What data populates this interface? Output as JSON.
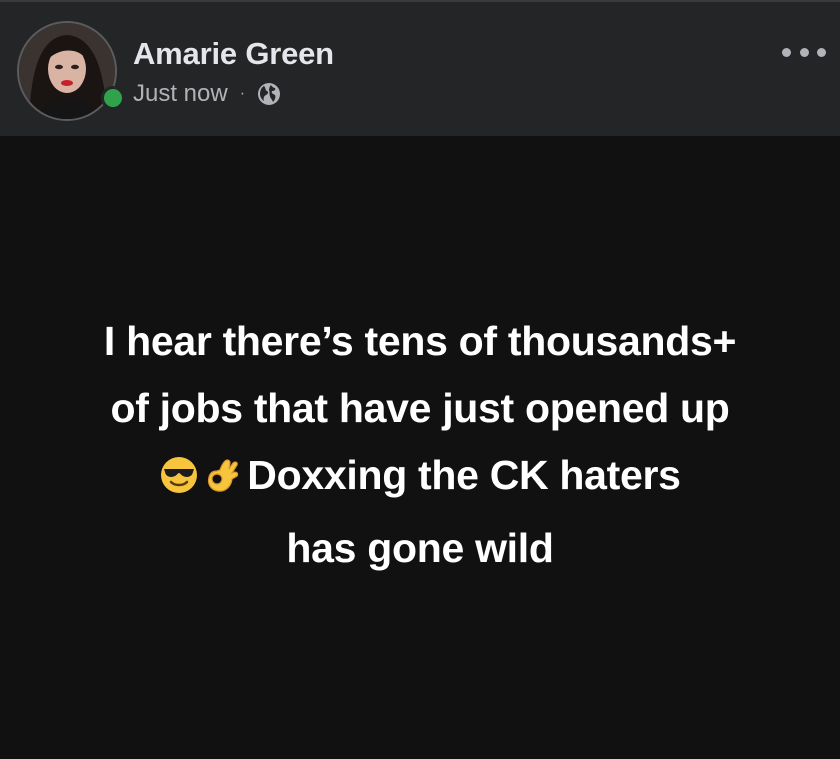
{
  "post": {
    "author": "Amarie Green",
    "timestamp": "Just now",
    "separator": "·",
    "privacy_icon": "globe-icon",
    "menu_icon": "more-options-icon",
    "status_color": "#31a24c",
    "text": {
      "line1": "I hear there’s tens of thousands+",
      "line2": "of jobs that have just opened up",
      "emoji1": "sunglasses-face-emoji",
      "emoji2": "ok-hand-emoji",
      "line3": "Doxxing the CK haters",
      "line4": "has gone wild"
    }
  },
  "colors": {
    "header_bg": "#242526",
    "body_bg": "#111111",
    "text": "#ffffff",
    "secondary_text": "#b0b3b8"
  }
}
